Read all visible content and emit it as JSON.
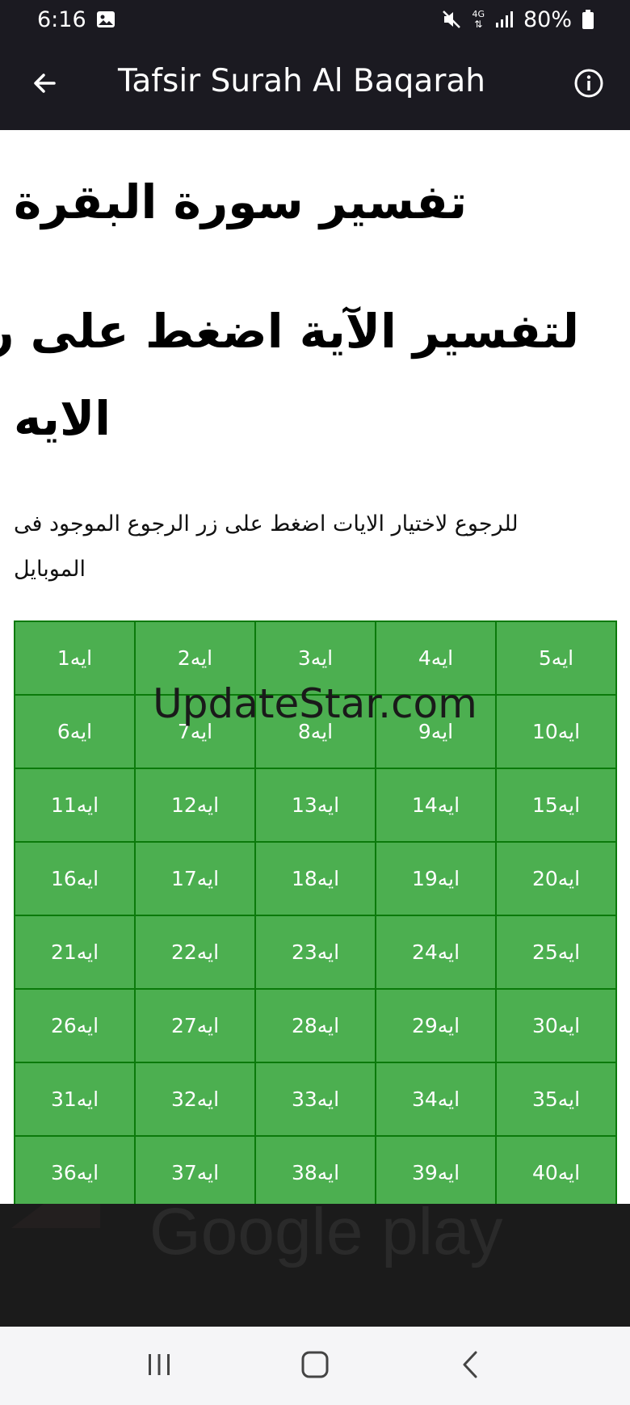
{
  "status_bar": {
    "time": "6:16",
    "network": "4G",
    "battery": "80%",
    "icons": [
      "image-icon",
      "mute-icon",
      "network-4g-icon",
      "signal-icon",
      "battery-icon"
    ]
  },
  "app_bar": {
    "title": "Tafsir Surah Al Baqarah",
    "icons": [
      "back-arrow-icon",
      "info-icon"
    ]
  },
  "content": {
    "heading_main": "تفسير سورة البقرة",
    "heading_sub_lines": [
      "لتفسير الآية اضغط على رقم",
      "الايه"
    ],
    "instruction_lines": [
      "للرجوع لاختيار الايات اضغط على زر الرجوع الموجود فى",
      "الموبايل"
    ]
  },
  "ayah_grid": {
    "cells": [
      "ايه1",
      "ايه2",
      "ايه3",
      "ايه4",
      "ايه5",
      "ايه6",
      "ايه7",
      "ايه8",
      "ايه9",
      "ايه10",
      "ايه11",
      "ايه12",
      "ايه13",
      "ايه14",
      "ايه15",
      "ايه16",
      "ايه17",
      "ايه18",
      "ايه19",
      "ايه20",
      "ايه21",
      "ايه22",
      "ايه23",
      "ايه24",
      "ايه25",
      "ايه26",
      "ايه27",
      "ايه28",
      "ايه29",
      "ايه30",
      "ايه31",
      "ايه32",
      "ايه33",
      "ايه34",
      "ايه35",
      "ايه36",
      "ايه37",
      "ايه38",
      "ايه39",
      "ايه40"
    ]
  },
  "watermark": "UpdateStar.com",
  "ad": {
    "ghost_text": "Google play"
  },
  "nav_bar": {
    "icons": [
      "recents-icon",
      "home-icon",
      "back-icon"
    ]
  },
  "colors": {
    "bar_bg": "#1b1a21",
    "cell_bg": "#4caf50",
    "cell_border": "#0b7a0b",
    "ad_bg": "#1b1b1b",
    "nav_bg": "#f5f5f7"
  }
}
